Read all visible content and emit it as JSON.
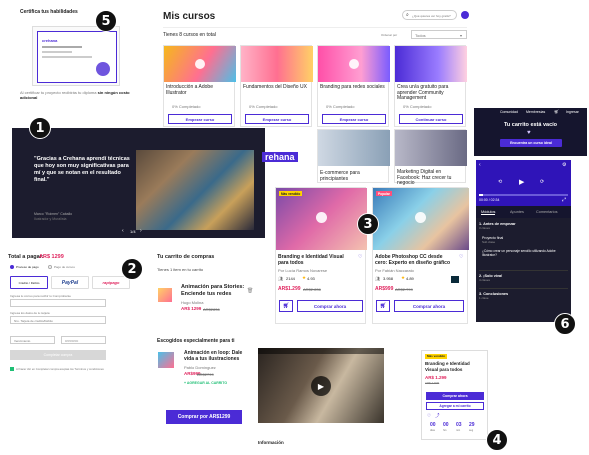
{
  "cert": {
    "title": "Certifica tus habilidades",
    "logo": "crehana",
    "desc_pre": "Al certificar tu proyecto recibirás tu diploma ",
    "desc_bold": "sin ningún costo adicional"
  },
  "courses": {
    "title": "Mis cursos",
    "search_placeholder": "¿Qué quieres ver hoy gratis?",
    "summary": "Tienes 8 cursos en total",
    "sort_label": "Ordenar por",
    "sort_value": "Todos",
    "top_cards": [
      {
        "title": "Introducción a Adobe Illustrator",
        "progress": "0% Completado",
        "btn": "Empezar curso",
        "color": "#f5b81c"
      },
      {
        "title": "Fundamentos del Diseño UX",
        "progress": "0% Completado",
        "btn": "Empezar curso",
        "color": "#ff6f91"
      },
      {
        "title": "Branding para redes sociales",
        "progress": "0% Completado",
        "btn": "Empezar curso",
        "color": "#ff4fa8"
      },
      {
        "title": "Crea un/a gratuito para aprender Community Management",
        "progress": "0% Completado",
        "btn": "Continuar curso",
        "color": "#4b2bd6"
      }
    ],
    "mid_cards": [
      {
        "title": "E-commerce para principiantes"
      },
      {
        "title": "Marketing Digital en Facebook: Haz crecer tu negocio"
      }
    ]
  },
  "testimonial": {
    "quote": "\"Gracias a Crehana aprendí técnicas que hoy son muy significativas para mí y que se notan en el resultado final.\"",
    "author": "Marco \"Roimen\" Caballo",
    "role": "Ilustrador y Muralista",
    "pager": "1/4"
  },
  "empty_cart": {
    "nav": [
      "Comunidad",
      "Membresías",
      "Ingresar"
    ],
    "title": "Tu carrito está vacío",
    "btn": "Encuentra un curso ideal"
  },
  "player": {
    "time": "00:00 / 02:34",
    "tabs": [
      "Módulos",
      "Apuntes",
      "Comentarios"
    ],
    "modules": [
      {
        "name": "1. Antes de empezar",
        "sub": "3 clases"
      },
      {
        "name": "Proyecto final",
        "sub": "Sub clase"
      },
      {
        "name": "¿Cómo crear un personaje sencillo utilizando Adobe Illustrator?",
        "sub": ""
      },
      {
        "name": "2. ¡Solo viva!",
        "sub": "4 clases"
      },
      {
        "name": "3. Conclusiones",
        "sub": "1 clase"
      }
    ]
  },
  "checkout": {
    "total_label": "Total a pagar:",
    "total": "AR$ 1299",
    "step1": "Proceso de pago",
    "step2": "Pago de cursos",
    "methods": [
      "Crédito / Débito",
      "PayPal",
      "rapipago"
    ],
    "email_label": "Ingresa tu correo para recibir tu Comprobante",
    "card_label": "Ingresa los datos de tu tarjeta",
    "card_placeholder": "Nro. Tarjeta de crédito/Débito",
    "exp_placeholder": "Vencimiento",
    "cvv_placeholder": "CVV/CVC",
    "pay_btn": "Completar compra",
    "terms": "Al hacer clic en Completar compra aceptas los Términos y condiciones"
  },
  "cart": {
    "title": "Tu carrito de compras",
    "count": "Tienes 1 item en tu carrito",
    "item": {
      "title": "Animación para Stories: Enciende tus redes",
      "author": "Hugo Molina",
      "price": "AR$ 1299",
      "old": "AR$2836"
    },
    "rec_title": "Escogidos especialmente para ti",
    "rec": {
      "title": "Animación en loop: Dale vida a tus ilustraciones",
      "author": "Pablo Domínguez",
      "price": "AR$999",
      "old": "AR$2799",
      "add": "+ AGREGAR AL CARRITO"
    },
    "buy_btn": "Comprar por AR$1299"
  },
  "catalog": {
    "cards": [
      {
        "badge": "Más vendido",
        "title": "Branding e Identidad Visual para todos",
        "author": "Por Lucía Ramos Novarese",
        "students": "2144",
        "rating": "4.93",
        "price": "AR$1.299",
        "old": "AR$2.836",
        "btn": "Comprar ahora"
      },
      {
        "badge": "Popular",
        "title": "Adobe Photoshop CC desde cero: Experto en diseño gráfico",
        "author": "Por Fabián Naccarato",
        "students": "3.958",
        "rating": "4.89",
        "price": "AR$999",
        "old": "AR$2.799",
        "btn": "Comprar ahora"
      }
    ]
  },
  "video": {
    "label": "Información"
  },
  "detail": {
    "badge": "Más vendido",
    "title": "Branding e Identidad Visual para todos",
    "price": "AR$ 1.299",
    "old": "AR$ 2.836",
    "buy": "Comprar ahora",
    "add": "Agregar a mi carrito",
    "countdown": [
      "00",
      "00",
      "03",
      "29"
    ],
    "units": [
      "días",
      "hrs",
      "min",
      "seg"
    ]
  },
  "badges": [
    "1",
    "2",
    "3",
    "4",
    "5",
    "6"
  ],
  "colors": {
    "brand": "#4b2bd6",
    "dark": "#15152e",
    "price": "#e0245e",
    "accent_green": "#1fbf75"
  }
}
